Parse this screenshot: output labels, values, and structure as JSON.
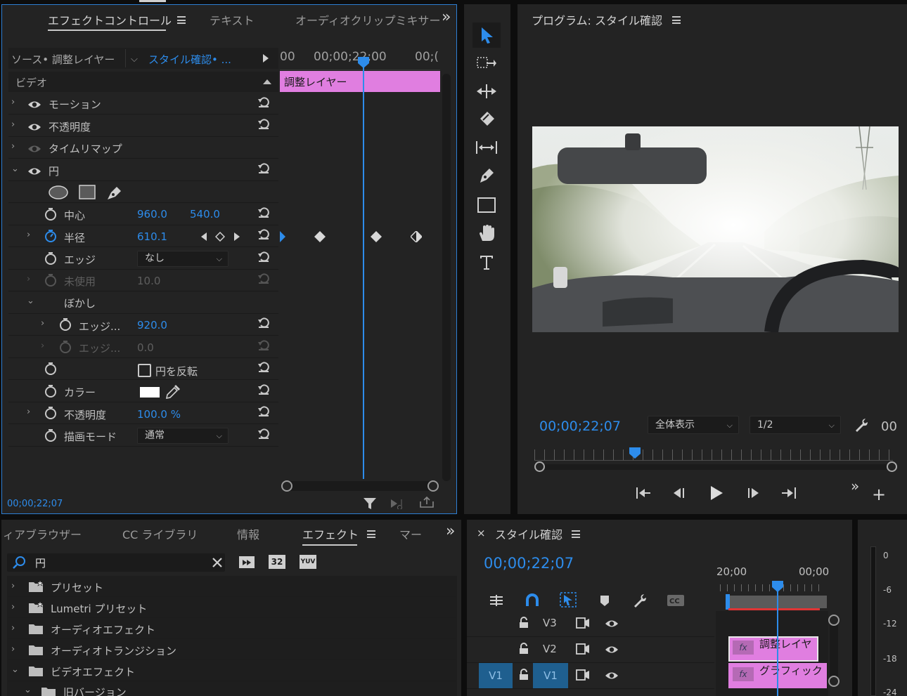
{
  "effect_panel": {
    "tabs": [
      "エフェクトコントロール",
      "テキスト",
      "オーディオクリップミキサー"
    ],
    "overflow": "»",
    "source_label": "ソース• 調整レイヤー",
    "sequence_label": "スタイル確認• ...",
    "ruler_left": "00",
    "ruler_mid": "00;00;22;00",
    "ruler_right": "00;(",
    "section": "ビデオ",
    "clip_name": "調整レイヤー",
    "rows": {
      "motion": "モーション",
      "opacity": "不透明度",
      "timeremap": "タイムリマップ",
      "circle": "円",
      "center": "中心",
      "center_x": "960.0",
      "center_y": "540.0",
      "radius": "半径",
      "radius_val": "610.1",
      "edge": "エッジ",
      "edge_val": "なし",
      "unused": "未使用",
      "unused_val": "10.0",
      "blur": "ぼかし",
      "edge1": "エッジ...",
      "edge1_val": "920.0",
      "edge2": "エッジ...",
      "edge2_val": "0.0",
      "invert": "円を反転",
      "color": "カラー",
      "opacity2": "不透明度",
      "opacity2_val": "100.0 %",
      "blend": "描画モード",
      "blend_val": "通常"
    },
    "timecode": "00;00;22;07"
  },
  "program": {
    "title": "プログラム: スタイル確認",
    "timecode": "00;00;22;07",
    "zoom": "全体表示",
    "resolution": "1/2",
    "trailing": "00"
  },
  "effects_browser": {
    "tabs": [
      "ィアブラウザー",
      "CC ライブラリ",
      "情報",
      "エフェクト",
      "マー"
    ],
    "search_value": "円",
    "filter_badges": [
      "32",
      "YUV"
    ],
    "items": [
      "プリセット",
      "Lumetri プリセット",
      "オーディオエフェクト",
      "オーディオトランジション",
      "ビデオエフェクト",
      "旧バージョン"
    ]
  },
  "timeline": {
    "title": "スタイル確認",
    "timecode": "00;00;22;07",
    "ruler_a": "20;00",
    "ruler_b": "00;00",
    "tracks": [
      {
        "name": "V3",
        "src": ""
      },
      {
        "name": "V2",
        "src": ""
      },
      {
        "name": "V1",
        "src": "V1"
      }
    ],
    "clip_adj": "調整レイヤ",
    "clip_graphic": "グラフィック",
    "fx": "fx"
  },
  "meter": {
    "labels": [
      "0",
      "-6",
      "-12",
      "-18",
      "-24"
    ]
  },
  "colors": {
    "accent": "#2d8ceb",
    "clip_pink": "#e07ee0",
    "panel_bg": "#232323"
  }
}
